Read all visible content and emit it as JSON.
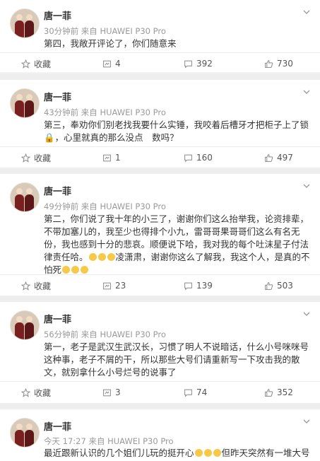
{
  "posts": [
    {
      "author": "唐一菲",
      "meta": "30分钟前 来自 HUAWEI P30 Pro",
      "text": "第四，我敞开评论了，你们随意来",
      "favorite_label": "收藏",
      "reposts": "4",
      "comments": "392",
      "likes": "730"
    },
    {
      "author": "唐一菲",
      "meta": "43分钟前 来自 HUAWEI P30 Pro",
      "text": "第三，奉劝你们别老找我要什么实锤，我咬着后槽牙才把柜子上了锁🔒，心里就真的那么没点　数吗？",
      "favorite_label": "收藏",
      "reposts": "1",
      "comments": "160",
      "likes": "497"
    },
    {
      "author": "唐一菲",
      "meta": "49分钟前 来自 HUAWEI P30 Pro",
      "text": "第二，你们说了我十年的小三了，谢谢你们这么抬举我，论资排辈，不带加塞儿的，我至少也得排个小九，雷哥哥果哥哥们这么有名无份，我也感到十分的悲哀。顺便说下哈，我对我的每个吐沫星子付法律责任哈。",
      "text_tail": "凌潇肃，谢谢你这么了解我，我这个人，是真的不怕死",
      "favorite_label": "收藏",
      "reposts": "23",
      "comments": "139",
      "likes": "503"
    },
    {
      "author": "唐一菲",
      "meta": "56分钟前 来自 HUAWEI P30 Pro",
      "text": "第一，老子是武汉生武汉长，习惯了明人不说暗话，什么小号咪咪号这种事，老子不屑的干，所以那些大号们请重新写一下攻击我的散文，就别拿什么小号烂号的说事了",
      "favorite_label": "收藏",
      "reposts": "3",
      "comments": "74",
      "likes": "352"
    },
    {
      "author": "唐一菲",
      "meta": "今天 17:27 来自 HUAWEI P30 Pro",
      "text": "最近跟新认识的几个姐们儿玩的挺开心",
      "text_tail": "但昨天突然有一堆大号"
    }
  ],
  "icons": {
    "favorite": "star-icon",
    "repost": "repost-icon",
    "comment": "comment-icon",
    "like": "thumbs-up-icon",
    "menu": "chevron-down-icon",
    "emoji": "laughing-emoji-icon"
  },
  "colors": {
    "text": "#333333",
    "meta": "#999999",
    "emoji": "#f7c948"
  }
}
